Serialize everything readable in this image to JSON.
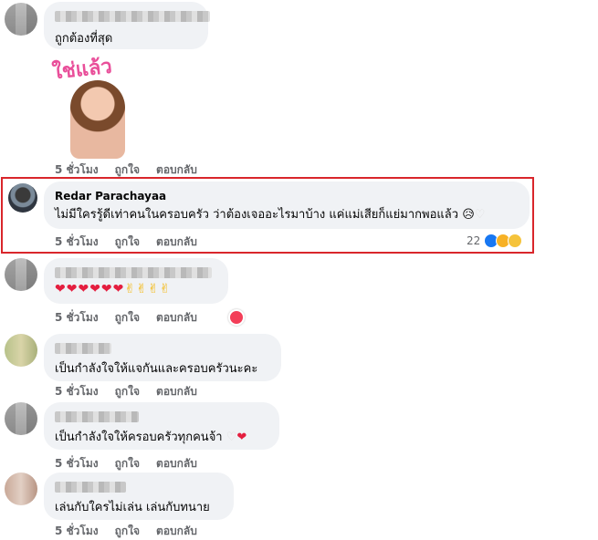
{
  "comments": [
    {
      "id": "c1",
      "name": "",
      "text": "ถูกต้องที่สุด",
      "sticker_text": "ใช่แล้ว",
      "time": "5 ชั่วโมง",
      "like": "ถูกใจ",
      "reply": "ตอบกลับ"
    },
    {
      "id": "c2",
      "name": "Redar Parachayaa",
      "text": "ไม่มีใครรู้ดีเท่าคนในครอบครัว ว่าต้องเจออะไรมาบ้าง แค่แม่เสียก็แย่มากพอแล้ว",
      "time": "5 ชั่วโมง",
      "like": "ถูกใจ",
      "reply": "ตอบกลับ",
      "reaction_count": "22"
    },
    {
      "id": "c3",
      "name": "",
      "text": "",
      "time": "5 ชั่วโมง",
      "like": "ถูกใจ",
      "reply": "ตอบกลับ"
    },
    {
      "id": "c4",
      "name": "",
      "text": "เป็นกำลังใจให้แจกันและครอบครัวนะคะ",
      "time": "5 ชั่วโมง",
      "like": "ถูกใจ",
      "reply": "ตอบกลับ"
    },
    {
      "id": "c5",
      "name": "",
      "text": "เป็นกำลังใจให้ครอบครัวทุกคนจ้า",
      "time": "5 ชั่วโมง",
      "like": "ถูกใจ",
      "reply": "ตอบกลับ"
    },
    {
      "id": "c6",
      "name": "",
      "text": "เล่นกับใครไม่เล่น เล่นกับทนาย",
      "time": "5 ชั่วโมง",
      "like": "ถูกใจ",
      "reply": "ตอบกลับ"
    }
  ],
  "colors": {
    "highlight": "#d9262b",
    "bubble": "#f0f2f5",
    "meta": "#65676b",
    "heart": "#e41e3f",
    "like_blue": "#1877f2"
  }
}
